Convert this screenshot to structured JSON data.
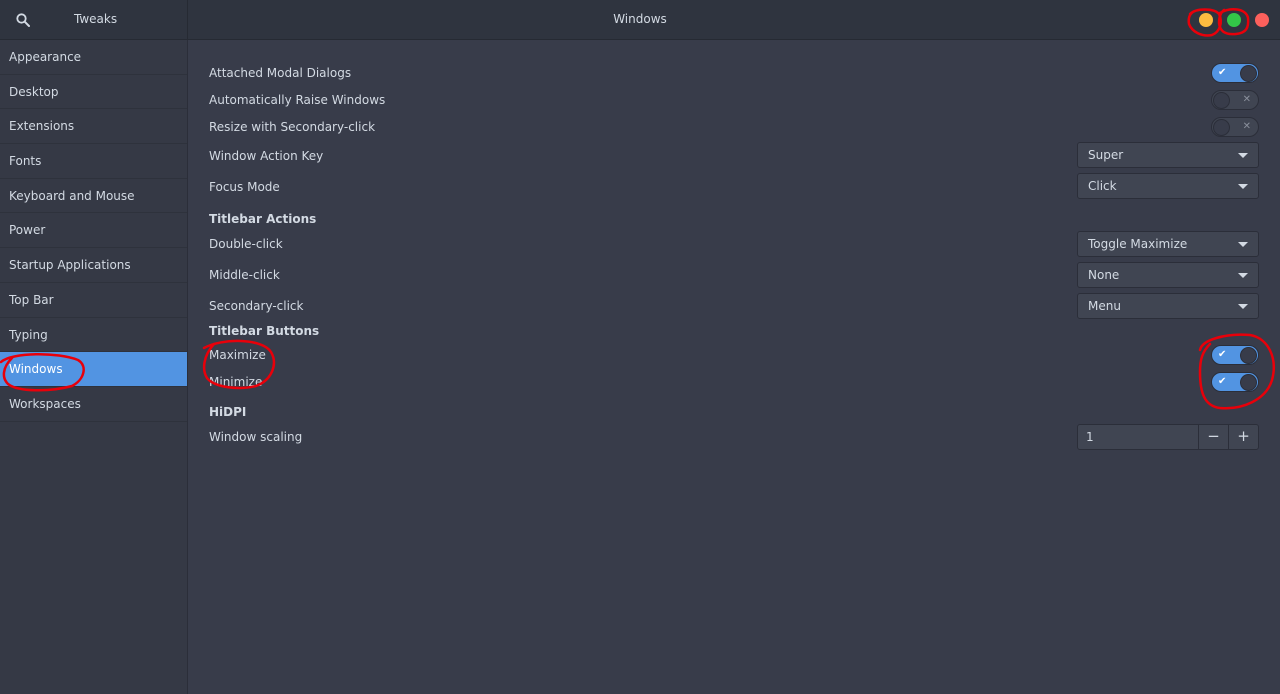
{
  "header": {
    "app_title": "Tweaks",
    "page_title": "Windows",
    "window_buttons": [
      {
        "name": "minimize",
        "color": "#fdbc40"
      },
      {
        "name": "maximize",
        "color": "#33c748"
      },
      {
        "name": "close",
        "color": "#fc605c"
      }
    ]
  },
  "sidebar": {
    "items": [
      {
        "label": "Appearance"
      },
      {
        "label": "Desktop"
      },
      {
        "label": "Extensions"
      },
      {
        "label": "Fonts"
      },
      {
        "label": "Keyboard and Mouse"
      },
      {
        "label": "Power"
      },
      {
        "label": "Startup Applications"
      },
      {
        "label": "Top Bar"
      },
      {
        "label": "Typing"
      },
      {
        "label": "Windows",
        "active": true
      },
      {
        "label": "Workspaces"
      }
    ]
  },
  "settings": {
    "attached_modal": {
      "label": "Attached Modal Dialogs",
      "on": true
    },
    "auto_raise": {
      "label": "Automatically Raise Windows",
      "on": false
    },
    "resize_secondary": {
      "label": "Resize with Secondary-click",
      "on": false
    },
    "action_key": {
      "label": "Window Action Key",
      "value": "Super"
    },
    "focus_mode": {
      "label": "Focus Mode",
      "value": "Click"
    },
    "titlebar_actions_heading": "Titlebar Actions",
    "double_click": {
      "label": "Double-click",
      "value": "Toggle Maximize"
    },
    "middle_click": {
      "label": "Middle-click",
      "value": "None"
    },
    "secondary_click": {
      "label": "Secondary-click",
      "value": "Menu"
    },
    "titlebar_buttons_heading": "Titlebar Buttons",
    "maximize": {
      "label": "Maximize",
      "on": true
    },
    "minimize": {
      "label": "Minimize",
      "on": true
    },
    "hidpi_heading": "HiDPI",
    "window_scaling": {
      "label": "Window scaling",
      "value": "1",
      "dec": "−",
      "inc": "+"
    }
  },
  "colors": {
    "accent": "#5294e2",
    "annotation": "#e8000a"
  }
}
